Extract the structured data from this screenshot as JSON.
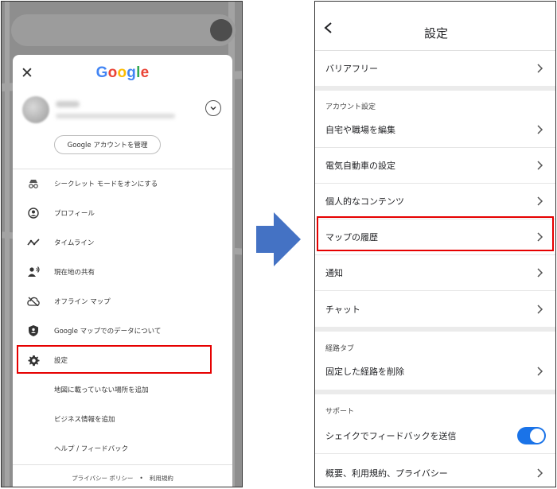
{
  "left_menu": {
    "logo": "Google",
    "manage_account": "Google アカウントを管理",
    "items": [
      {
        "label": "シークレット モードをオンにする",
        "icon": "incognito-icon"
      },
      {
        "label": "プロフィール",
        "icon": "profile-icon"
      },
      {
        "label": "タイムライン",
        "icon": "timeline-icon"
      },
      {
        "label": "現在地の共有",
        "icon": "location-share-icon"
      },
      {
        "label": "オフライン マップ",
        "icon": "offline-cloud-icon"
      },
      {
        "label": "Google マップでのデータについて",
        "icon": "shield-icon"
      },
      {
        "label": "設定",
        "icon": "gear-icon"
      },
      {
        "label": "地図に載っていない場所を追加"
      },
      {
        "label": "ビジネス情報を追加"
      },
      {
        "label": "ヘルプ / フィードバック"
      }
    ],
    "footer": {
      "privacy": "プライバシー ポリシー",
      "dot": "•",
      "terms": "利用規約"
    }
  },
  "settings": {
    "title": "設定",
    "top_item": "バリアフリー",
    "account_section": "アカウント設定",
    "account_items": [
      "自宅や職場を編集",
      "電気自動車の設定",
      "個人的なコンテンツ",
      "マップの履歴",
      "通知",
      "チャット"
    ],
    "route_section": "経路タブ",
    "route_items": [
      "固定した経路を削除"
    ],
    "support_section": "サポート",
    "shake_feedback": "シェイクでフィードバックを送信",
    "shake_feedback_enabled": true,
    "about_item": "概要、利用規約、プライバシー"
  },
  "colors": {
    "highlight": "#e60000",
    "arrow": "#4472c4",
    "toggle_on": "#1a73e8"
  }
}
